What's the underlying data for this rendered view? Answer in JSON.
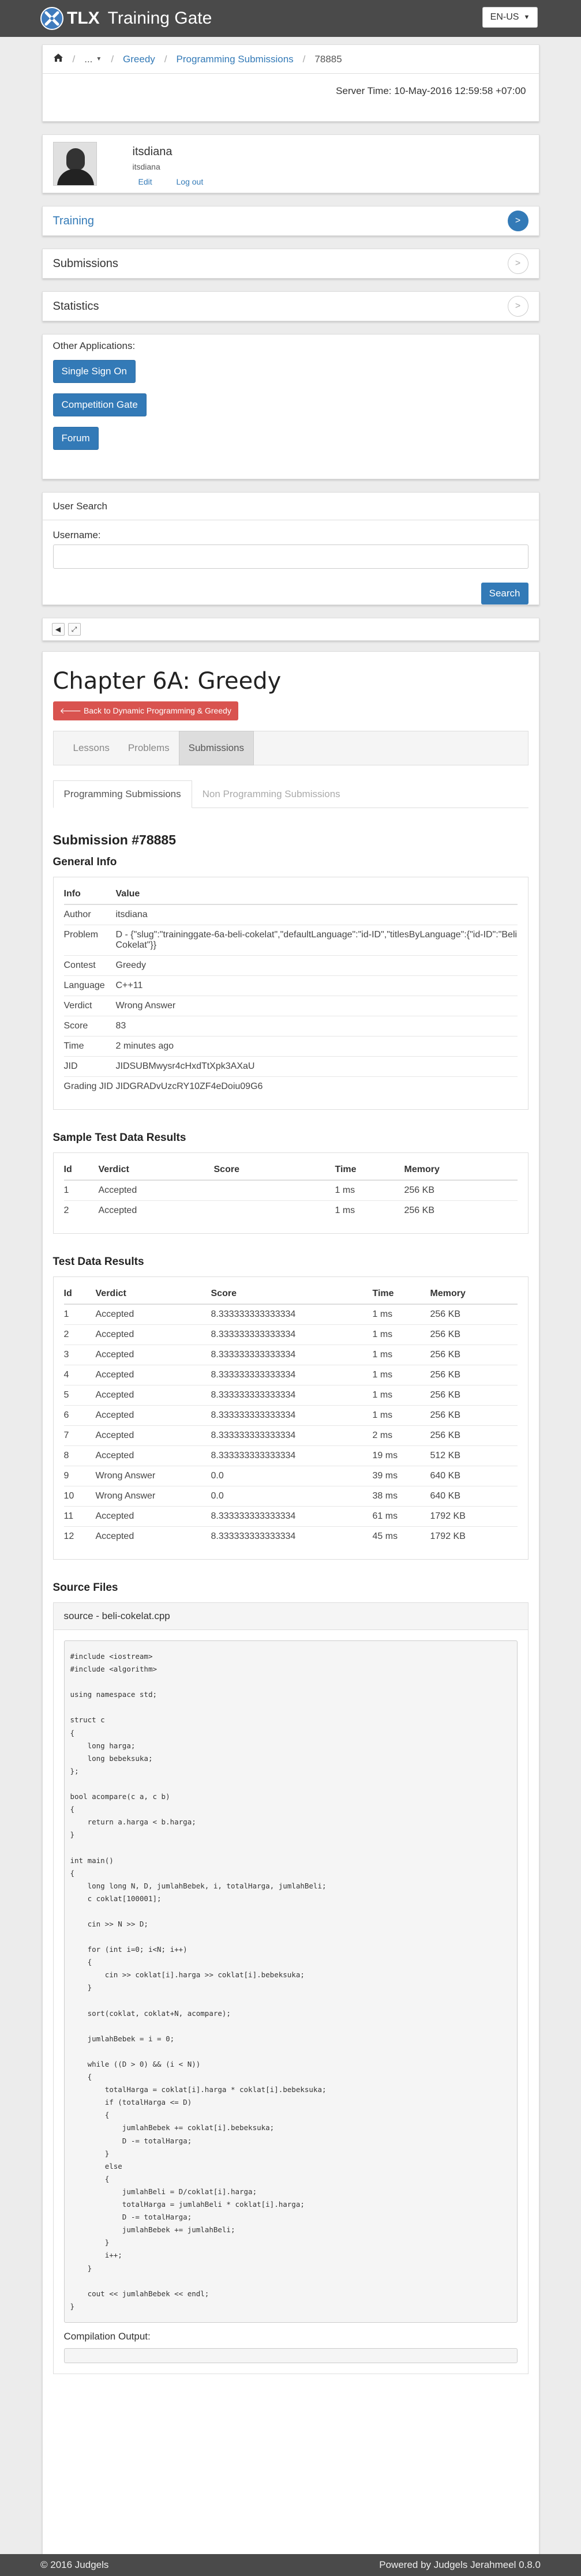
{
  "header": {
    "logo_text": "TLX",
    "app_title": "Training Gate",
    "language": "EN-US"
  },
  "breadcrumb": {
    "dots": "...",
    "items": [
      "Greedy",
      "Programming Submissions",
      "78885"
    ]
  },
  "server_time": "Server Time: 10-May-2016 12:59:58 +07:00",
  "profile": {
    "name": "itsdiana",
    "username": "itsdiana",
    "edit_label": "Edit",
    "logout_label": "Log out"
  },
  "menu": [
    {
      "label": "Training",
      "active": true
    },
    {
      "label": "Submissions",
      "active": false
    },
    {
      "label": "Statistics",
      "active": false
    }
  ],
  "apps": {
    "title": "Other Applications:",
    "buttons": [
      "Single Sign On",
      "Competition Gate",
      "Forum"
    ]
  },
  "user_search": {
    "title": "User Search",
    "label": "Username:",
    "button": "Search"
  },
  "page": {
    "title": "Chapter 6A: Greedy",
    "back_button": "Back to Dynamic Programming & Greedy",
    "tabs": [
      "Lessons",
      "Problems",
      "Submissions"
    ],
    "active_tab": "Submissions",
    "subtabs": [
      "Programming Submissions",
      "Non Programming Submissions"
    ],
    "submission_title": "Submission #78885"
  },
  "general_info": {
    "title": "General Info",
    "headers": [
      "Info",
      "Value"
    ],
    "rows": [
      [
        "Author",
        "itsdiana"
      ],
      [
        "Problem",
        "D - {\"slug\":\"traininggate-6a-beli-cokelat\",\"defaultLanguage\":\"id-ID\",\"titlesByLanguage\":{\"id-ID\":\"Beli Cokelat\"}}"
      ],
      [
        "Contest",
        "Greedy"
      ],
      [
        "Language",
        "C++11"
      ],
      [
        "Verdict",
        "Wrong Answer"
      ],
      [
        "Score",
        "83"
      ],
      [
        "Time",
        "2 minutes ago"
      ],
      [
        "JID",
        "JIDSUBMwysr4cHxdTtXpk3AXaU"
      ],
      [
        "Grading JID",
        "JIDGRADvUzcRY10ZF4eDoiu09G6"
      ]
    ]
  },
  "sample_results": {
    "title": "Sample Test Data Results",
    "headers": [
      "Id",
      "Verdict",
      "Score",
      "Time",
      "Memory"
    ],
    "rows": [
      [
        "1",
        "Accepted",
        "",
        "1 ms",
        "256 KB"
      ],
      [
        "2",
        "Accepted",
        "",
        "1 ms",
        "256 KB"
      ]
    ]
  },
  "test_results": {
    "title": "Test Data Results",
    "headers": [
      "Id",
      "Verdict",
      "Score",
      "Time",
      "Memory"
    ],
    "rows": [
      [
        "1",
        "Accepted",
        "8.333333333333334",
        "1 ms",
        "256 KB"
      ],
      [
        "2",
        "Accepted",
        "8.333333333333334",
        "1 ms",
        "256 KB"
      ],
      [
        "3",
        "Accepted",
        "8.333333333333334",
        "1 ms",
        "256 KB"
      ],
      [
        "4",
        "Accepted",
        "8.333333333333334",
        "1 ms",
        "256 KB"
      ],
      [
        "5",
        "Accepted",
        "8.333333333333334",
        "1 ms",
        "256 KB"
      ],
      [
        "6",
        "Accepted",
        "8.333333333333334",
        "1 ms",
        "256 KB"
      ],
      [
        "7",
        "Accepted",
        "8.333333333333334",
        "2 ms",
        "256 KB"
      ],
      [
        "8",
        "Accepted",
        "8.333333333333334",
        "19 ms",
        "512 KB"
      ],
      [
        "9",
        "Wrong Answer",
        "0.0",
        "39 ms",
        "640 KB"
      ],
      [
        "10",
        "Wrong Answer",
        "0.0",
        "38 ms",
        "640 KB"
      ],
      [
        "11",
        "Accepted",
        "8.333333333333334",
        "61 ms",
        "1792 KB"
      ],
      [
        "12",
        "Accepted",
        "8.333333333333334",
        "45 ms",
        "1792 KB"
      ]
    ]
  },
  "source": {
    "title": "Source Files",
    "file_label": "source - beli-cokelat.cpp",
    "code": "#include <iostream>\n#include <algorithm>\n\nusing namespace std;\n\nstruct c\n{\n    long harga;\n    long bebeksuka;\n};\n\nbool acompare(c a, c b)\n{\n    return a.harga < b.harga;\n}\n\nint main()\n{\n    long long N, D, jumlahBebek, i, totalHarga, jumlahBeli;\n    c coklat[100001];\n\n    cin >> N >> D;\n\n    for (int i=0; i<N; i++)\n    {\n        cin >> coklat[i].harga >> coklat[i].bebeksuka;\n    }\n\n    sort(coklat, coklat+N, acompare);\n\n    jumlahBebek = i = 0;\n\n    while ((D > 0) && (i < N))\n    {\n        totalHarga = coklat[i].harga * coklat[i].bebeksuka;\n        if (totalHarga <= D)\n        {\n            jumlahBebek += coklat[i].bebeksuka;\n            D -= totalHarga;\n        }\n        else\n        {\n            jumlahBeli = D/coklat[i].harga;\n            totalHarga = jumlahBeli * coklat[i].harga;\n            D -= totalHarga;\n            jumlahBebek += jumlahBeli;\n        }\n        i++;\n    }\n\n    cout << jumlahBebek << endl;\n}",
    "compilation_label": "Compilation Output:",
    "compilation_output": ""
  },
  "footer": {
    "left": "© 2016 Judgels",
    "right": "Powered by Judgels Jerahmeel 0.8.0"
  },
  "colors": {
    "navbar": "#4a4a4a",
    "primary": "#337ab7",
    "danger": "#d9534f"
  }
}
